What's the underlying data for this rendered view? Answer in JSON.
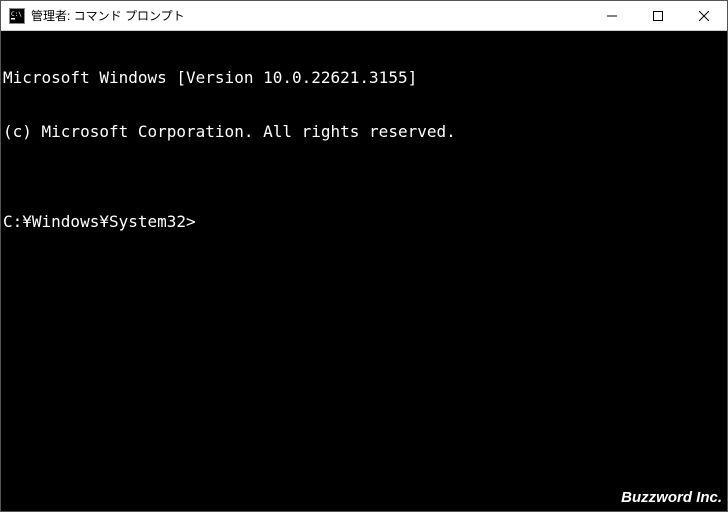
{
  "titlebar": {
    "icon_name": "cmd-icon",
    "title": "管理者: コマンド プロンプト",
    "controls": {
      "minimize": "minimize",
      "maximize": "maximize",
      "close": "close"
    }
  },
  "terminal": {
    "lines": [
      "Microsoft Windows [Version 10.0.22621.3155]",
      "(c) Microsoft Corporation. All rights reserved.",
      ""
    ],
    "prompt": "C:¥Windows¥System32>",
    "input": ""
  },
  "watermark": "Buzzword Inc."
}
